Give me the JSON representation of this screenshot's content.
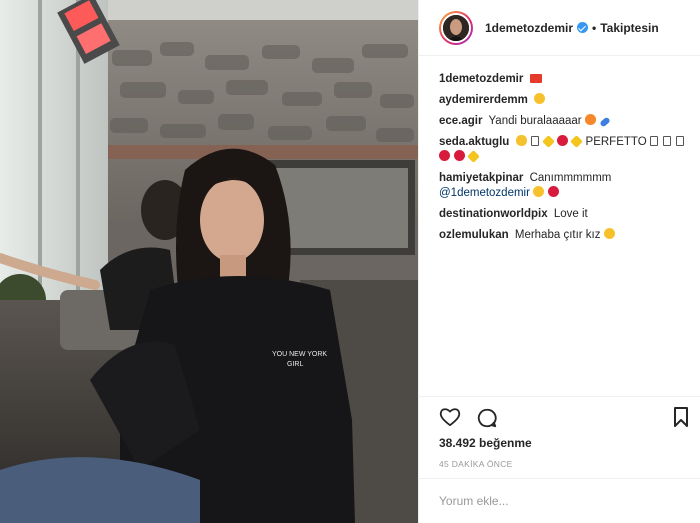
{
  "post": {
    "username": "1demetozdemir",
    "verified": true,
    "follow_state": "Takiptesin"
  },
  "comments": [
    {
      "user": "1demetozdemir",
      "text": "",
      "emoji": [
        "flag"
      ]
    },
    {
      "user": "aydemirerdemm",
      "text": "",
      "emoji": [
        "face"
      ]
    },
    {
      "user": "ece.agir",
      "text": "Yandi buralaaaaar",
      "emoji": [
        "fire",
        "pill"
      ]
    },
    {
      "user": "seda.aktuglu",
      "text": "PERFETTO",
      "emoji": [
        "ok",
        "box",
        "spark",
        "heart",
        "spark"
      ],
      "emoji_after": [
        "box",
        "box",
        "box"
      ],
      "line2_emoji": [
        "heart",
        "heart",
        "spark"
      ]
    },
    {
      "user": "hamiyetakpinar",
      "text": "Canımmmmmm",
      "mention": "@1demetozdemir",
      "emoji": [
        "face",
        "heart"
      ]
    },
    {
      "user": "destinationworldpix",
      "text": "Love it",
      "emoji": []
    },
    {
      "user": "ozlemulukan",
      "text": "Merhaba çıtır kız",
      "emoji": [
        "face"
      ]
    }
  ],
  "actions": {
    "like_icon": "heart-icon",
    "comment_icon": "comment-bubble-icon",
    "save_icon": "bookmark-icon"
  },
  "likes_text": "38.492 beğenme",
  "timestamp": "45 DAKİKA ÖNCE",
  "add_comment_placeholder": "Yorum ekle...",
  "colors": {
    "text": "#262626",
    "muted": "#999999",
    "mention": "#003569",
    "verified": "#3897f0",
    "border": "#efefef"
  },
  "photo": {
    "shirt_text_line1": "YOU NEW YORK",
    "shirt_text_line2": "GIRL"
  }
}
